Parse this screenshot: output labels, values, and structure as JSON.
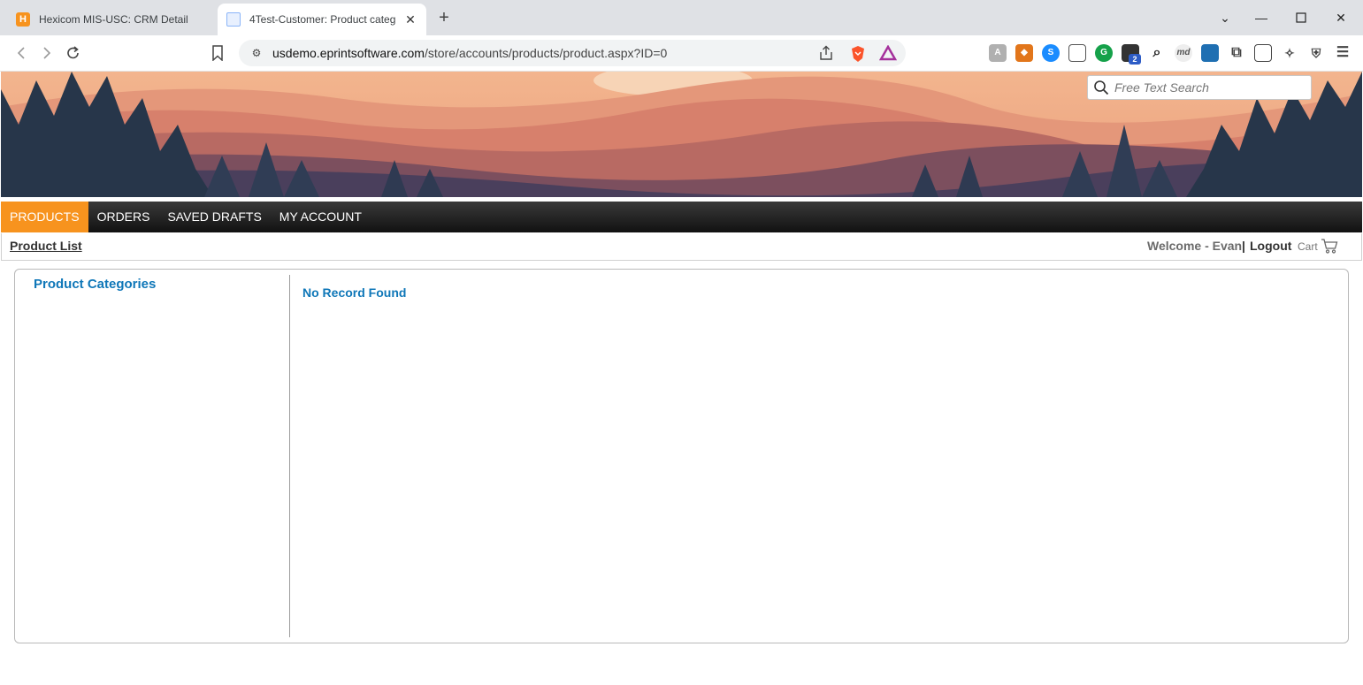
{
  "browser": {
    "tabs": [
      {
        "title": "Hexicom MIS-USC: CRM Detail",
        "favicon": "hexicom-icon",
        "active": false
      },
      {
        "title": "4Test-Customer: Product categ",
        "favicon": "page-icon",
        "active": true
      }
    ],
    "url_host": "usdemo.eprintsoftware.com",
    "url_path": "/store/accounts/products/product.aspx?ID=0",
    "extensions": [
      {
        "name": "ext-a-icon",
        "color": "#9e9e9e"
      },
      {
        "name": "metamask-icon",
        "color": "#e2761b"
      },
      {
        "name": "shazam-icon",
        "color": "#1a8cff"
      },
      {
        "name": "pip-icon",
        "color": "#555555"
      },
      {
        "name": "grammarly-icon",
        "color": "#15a14a"
      },
      {
        "name": "ext-badge-icon",
        "color": "#333333",
        "badge": "2"
      },
      {
        "name": "magnifier-ext-icon",
        "color": "#222222"
      },
      {
        "name": "markdown-icon",
        "color": "#666666",
        "label": "md"
      },
      {
        "name": "ext-flag-icon",
        "color": "#1f6fb2"
      },
      {
        "name": "puzzle-icon",
        "color": "#444444"
      },
      {
        "name": "wallet-icon",
        "color": "#444444"
      },
      {
        "name": "leo-icon",
        "color": "#444444"
      },
      {
        "name": "vpn-icon",
        "color": "#444444"
      },
      {
        "name": "menu-icon",
        "color": "#444444"
      }
    ]
  },
  "header": {
    "search_placeholder": "Free Text Search"
  },
  "nav": {
    "items": [
      {
        "label": "PRODUCTS",
        "active": true
      },
      {
        "label": "ORDERS",
        "active": false
      },
      {
        "label": "SAVED DRAFTS",
        "active": false
      },
      {
        "label": "MY ACCOUNT",
        "active": false
      }
    ]
  },
  "subbar": {
    "breadcrumb": "Product List",
    "welcome": "Welcome - Evan",
    "separator": "|",
    "logout": "Logout",
    "cart": "Cart"
  },
  "content": {
    "categories_heading": "Product Categories",
    "empty_message": "No Record Found"
  },
  "colors": {
    "accent": "#f7931e",
    "link_blue": "#0f77b8",
    "menubar": "#1f1f1f"
  }
}
